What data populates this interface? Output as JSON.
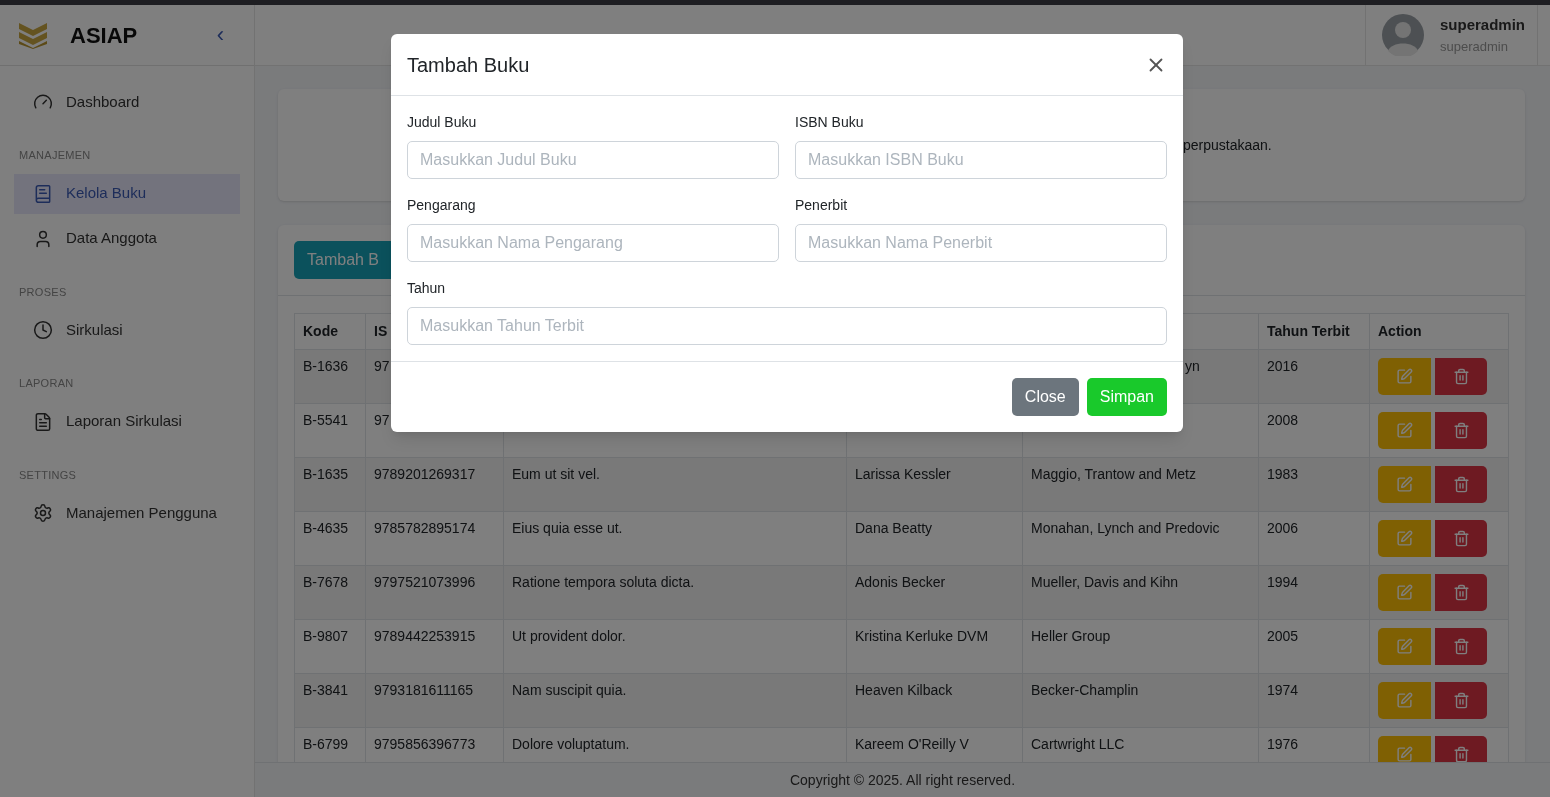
{
  "sidebar": {
    "brand": "ASIAP",
    "collapse": "‹",
    "sections": [
      {
        "items": [
          {
            "label": "Dashboard",
            "selected": false
          }
        ]
      },
      {
        "heading": "MANAJEMEN",
        "items": [
          {
            "label": "Kelola Buku",
            "selected": true
          },
          {
            "label": "Data Anggota",
            "selected": false
          }
        ]
      },
      {
        "heading": "PROSES",
        "items": [
          {
            "label": "Sirkulasi",
            "selected": false
          }
        ]
      },
      {
        "heading": "LAPORAN",
        "items": [
          {
            "label": "Laporan Sirkulasi",
            "selected": false
          }
        ]
      },
      {
        "heading": "SETTINGS",
        "items": [
          {
            "label": "Manajemen Pengguna",
            "selected": false
          }
        ]
      }
    ]
  },
  "user": {
    "name": "superadmin",
    "role": "superadmin"
  },
  "info_card": {
    "text": "perpustakaan."
  },
  "add_button": "Tambah B",
  "table": {
    "columns": [
      "Kode",
      "IS",
      "",
      "",
      "",
      "Tahun Terbit",
      "Action"
    ],
    "rows": [
      {
        "kode": "B-1636",
        "isbn": "97",
        "penerbit": "yn",
        "tahun": "2016"
      },
      {
        "kode": "B-5541",
        "isbn": "97",
        "tahun": "2008"
      },
      {
        "kode": "B-1635",
        "isbn": "9789201269317",
        "judul": "Eum ut sit vel.",
        "pengarang": "Larissa Kessler",
        "penerbit": "Maggio, Trantow and Metz",
        "tahun": "1983"
      },
      {
        "kode": "B-4635",
        "isbn": "9785782895174",
        "judul": "Eius quia esse ut.",
        "pengarang": "Dana Beatty",
        "penerbit": "Monahan, Lynch and Predovic",
        "tahun": "2006"
      },
      {
        "kode": "B-7678",
        "isbn": "9797521073996",
        "judul": "Ratione tempora soluta dicta.",
        "pengarang": "Adonis Becker",
        "penerbit": "Mueller, Davis and Kihn",
        "tahun": "1994"
      },
      {
        "kode": "B-9807",
        "isbn": "9789442253915",
        "judul": "Ut provident dolor.",
        "pengarang": "Kristina Kerluke DVM",
        "penerbit": "Heller Group",
        "tahun": "2005"
      },
      {
        "kode": "B-3841",
        "isbn": "9793181611165",
        "judul": "Nam suscipit quia.",
        "pengarang": "Heaven Kilback",
        "penerbit": "Becker-Champlin",
        "tahun": "1974"
      },
      {
        "kode": "B-6799",
        "isbn": "9795856396773",
        "judul": "Dolore voluptatum.",
        "pengarang": "Kareem O'Reilly V",
        "penerbit": "Cartwright LLC",
        "tahun": "1976"
      }
    ]
  },
  "footer": "Copyright © 2025. All right reserved.",
  "modal": {
    "title": "Tambah Buku",
    "fields": [
      {
        "label": "Judul Buku",
        "placeholder": "Masukkan Judul Buku"
      },
      {
        "label": "ISBN Buku",
        "placeholder": "Masukkan ISBN Buku"
      },
      {
        "label": "Pengarang",
        "placeholder": "Masukkan Nama Pengarang"
      },
      {
        "label": "Penerbit",
        "placeholder": "Masukkan Nama Penerbit"
      },
      {
        "label": "Tahun",
        "placeholder": "Masukkan Tahun Terbit"
      }
    ],
    "buttons": [
      {
        "label": "Close",
        "kind": "secondary"
      },
      {
        "label": "Simpan",
        "kind": "primary"
      }
    ]
  }
}
